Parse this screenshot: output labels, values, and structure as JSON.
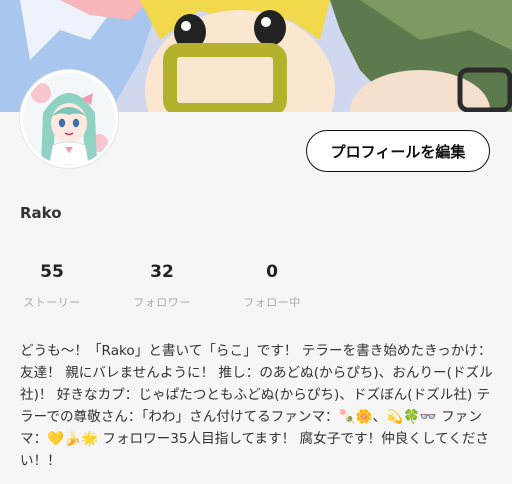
{
  "profile": {
    "username": "Rako",
    "edit_button_label": "プロフィールを編集"
  },
  "stats": [
    {
      "value": "55",
      "label": "ストーリー"
    },
    {
      "value": "32",
      "label": "フォロワー"
    },
    {
      "value": "0",
      "label": "フォロー中"
    }
  ],
  "bio": "どうも〜！「Rako」と書いて「らこ」です！ テラーを書き始めたきっかけ：友達！ 親にバレませんように！ 推し：のあどぬ(からぴち)、おんりー(ドズル社)！ 好きなカプ：じゃぱたつともふどぬ(からぴち)、ドズぼん(ドズル社) テラーでの尊敬さん：「わわ」さん付けてるファンマ：🍡🌼、💫🍀👓 ファンマ：💛🍌🌟 フォロワー35人目指してます！ 腐女子です！仲良くしてください！！",
  "colors": {
    "background": "#f6f6f7",
    "button_border": "#111111",
    "label_gray": "#aaaaaa"
  }
}
